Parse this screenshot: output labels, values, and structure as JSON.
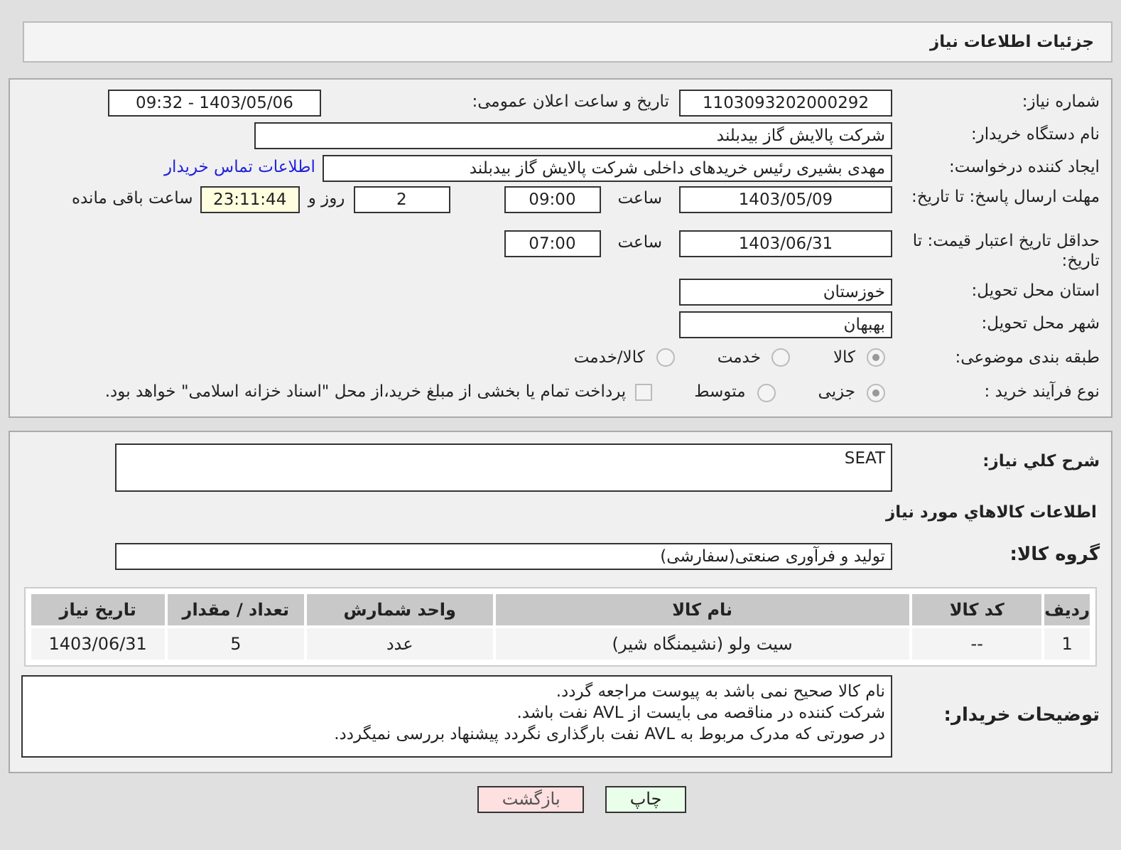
{
  "header": {
    "title": "جزئیات اطلاعات نیاز"
  },
  "need_number": {
    "label": "شماره نیاز:",
    "value": "1103093202000292"
  },
  "announce": {
    "label": "تاریخ و ساعت اعلان عمومی:",
    "value": "1403/05/06 - 09:32"
  },
  "buyer_org": {
    "label": "نام دستگاه خریدار:",
    "value": "شرکت پالایش گاز بیدبلند"
  },
  "requester": {
    "label": "ایجاد کننده درخواست:",
    "value": "مهدی بشیری رئیس خریدهای داخلی شرکت پالایش گاز بیدبلند",
    "link": "اطلاعات تماس خریدار"
  },
  "deadline": {
    "label": "مهلت ارسال پاسخ: تا تاریخ:",
    "date": "1403/05/09",
    "time_label": "ساعت",
    "time": "09:00",
    "days": "2",
    "days_label": "روز و",
    "remaining": "23:11:44",
    "remaining_label": "ساعت باقی مانده"
  },
  "price_validity": {
    "label": "حداقل تاریخ اعتبار قیمت: تا تاریخ:",
    "date": "1403/06/31",
    "time_label": "ساعت",
    "time": "07:00"
  },
  "province": {
    "label": "استان محل تحویل:",
    "value": "خوزستان"
  },
  "city": {
    "label": "شهر محل تحویل:",
    "value": "بهبهان"
  },
  "category": {
    "label": "طبقه بندی موضوعی:",
    "options": [
      {
        "label": "کالا",
        "selected": true
      },
      {
        "label": "خدمت",
        "selected": false
      },
      {
        "label": "کالا/خدمت",
        "selected": false
      }
    ]
  },
  "purchase_type": {
    "label": "نوع فرآیند خرید :",
    "options": [
      {
        "label": "جزیی",
        "selected": true
      },
      {
        "label": "متوسط",
        "selected": false
      }
    ],
    "payment": {
      "checked": false,
      "text": "پرداخت تمام یا بخشی از مبلغ خرید،از محل \"اسناد خزانه اسلامی\" خواهد بود."
    }
  },
  "description": {
    "label": "شرح کلي نياز:",
    "value": "SEAT"
  },
  "goods_title": "اطلاعات کالاهاي مورد نياز",
  "goods_group": {
    "label": "گروه کالا:",
    "value": "تولید و فرآوری صنعتی(سفارشی)"
  },
  "table": {
    "columns": [
      "ردیف",
      "کد کالا",
      "نام کالا",
      "واحد شمارش",
      "تعداد / مقدار",
      "تاریخ نیاز"
    ],
    "rows": [
      [
        "1",
        "--",
        "سیت ولو (نشیمنگاه شیر)",
        "عدد",
        "5",
        "1403/06/31"
      ]
    ]
  },
  "buyer_notes": {
    "label": "توضیحات خریدار:",
    "lines": [
      "نام کالا صحیح نمی باشد به پیوست مراجعه گردد.",
      "شرکت کننده در مناقصه می بایست از AVL نفت باشد.",
      "در صورتی که مدرک مربوط به AVL نفت بارگذاری نگردد پیشنهاد بررسی نمیگردد."
    ]
  },
  "buttons": [
    {
      "label": "چاپ",
      "kind": "print"
    },
    {
      "label": "بازگشت",
      "kind": "back"
    }
  ]
}
